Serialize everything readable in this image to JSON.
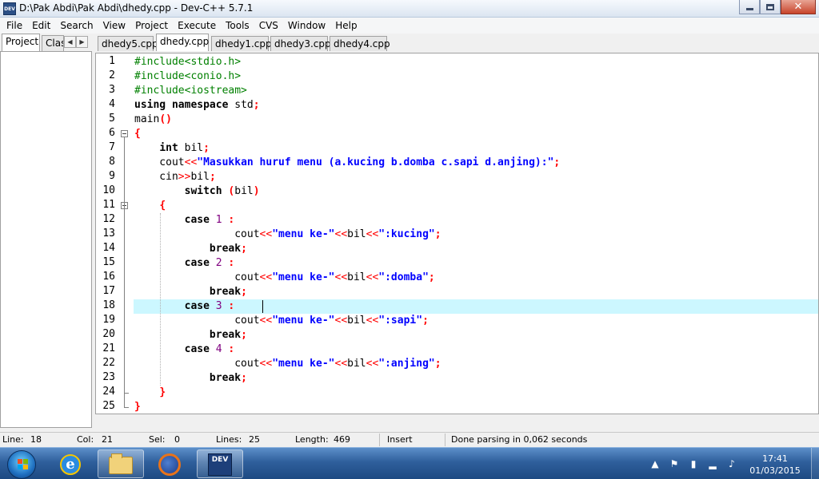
{
  "window": {
    "title": "D:\\Pak Abdi\\Pak Abdi\\dhedy.cpp - Dev-C++ 5.7.1",
    "app_icon_text": "DEV"
  },
  "menu": [
    "File",
    "Edit",
    "Search",
    "View",
    "Project",
    "Execute",
    "Tools",
    "CVS",
    "Window",
    "Help"
  ],
  "panel_tabs": [
    "Project",
    "Clas"
  ],
  "file_tabs": [
    "dhedy5.cpp",
    "dhedy.cpp",
    "dhedy1.cpp",
    "dhedy3.cpp",
    "dhedy4.cpp"
  ],
  "active_file_tab": "dhedy.cpp",
  "editor": {
    "current_line": 18,
    "lines": [
      "#include<stdio.h>",
      "#include<conio.h>",
      "#include<iostream>",
      "using namespace std;",
      "main()",
      "{",
      "    int bil;",
      "    cout<<\"Masukkan huruf menu (a.kucing b.domba c.sapi d.anjing):\";",
      "    cin>>bil;",
      "        switch (bil)",
      "    {",
      "        case 1 :",
      "                cout<<\"menu ke-\"<<bil<<\":kucing\";",
      "            break;",
      "        case 2 :",
      "                cout<<\"menu ke-\"<<bil<<\":domba\";",
      "            break;",
      "        case 3 :",
      "                cout<<\"menu ke-\"<<bil<<\":sapi\";",
      "            break;",
      "        case 4 :",
      "                cout<<\"menu ke-\"<<bil<<\":anjing\";",
      "            break;",
      "    }",
      "}"
    ]
  },
  "status": {
    "line_label": "Line:",
    "line_value": "18",
    "col_label": "Col:",
    "col_value": "21",
    "sel_label": "Sel:",
    "sel_value": "0",
    "lines_label": "Lines:",
    "lines_value": "25",
    "length_label": "Length:",
    "length_value": "469",
    "mode": "Insert",
    "message": "Done parsing in 0,062 seconds"
  },
  "taskbar": {
    "dev_label": "DEV",
    "time": "17:41",
    "date": "01/03/2015"
  },
  "colors": {
    "preprocessor": "#008000",
    "string": "#0000ff",
    "operator": "#ff0000",
    "number": "#800080",
    "current_line_bg": "#ccf7ff"
  }
}
